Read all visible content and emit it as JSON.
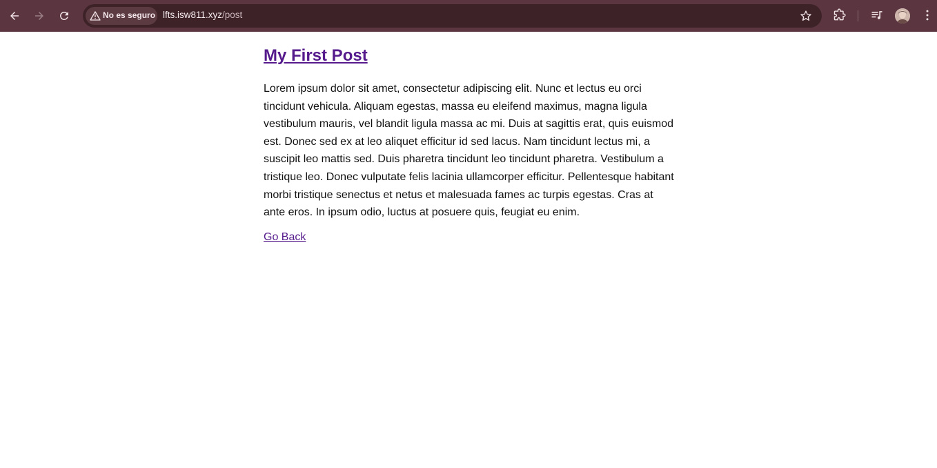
{
  "browser": {
    "security_label": "No es seguro",
    "url_host": "lfts.isw811.xyz",
    "url_path": "/post",
    "toolbar_color": "#5b3540",
    "icons": [
      "back-arrow-icon",
      "forward-arrow-icon",
      "reload-icon",
      "warning-icon",
      "star-icon",
      "extensions-icon",
      "media-control-icon",
      "avatar",
      "kebab-menu-icon"
    ]
  },
  "post": {
    "title": "My First Post",
    "body": "Lorem ipsum dolor sit amet, consectetur adipiscing elit. Nunc et lectus eu orci tincidunt vehicula. Aliquam egestas, massa eu eleifend maximus, magna ligula vestibulum mauris, vel blandit ligula massa ac mi. Duis at sagittis erat, quis euismod est. Donec sed ex at leo aliquet efficitur id sed lacus. Nam tincidunt lectus mi, a suscipit leo mattis sed. Duis pharetra tincidunt leo tincidunt pharetra. Vestibulum a tristique leo. Donec vulputate felis lacinia ullamcorper efficitur. Pellentesque habitant morbi tristique senectus et netus et malesuada fames ac turpis egestas. Cras at ante eros. In ipsum odio, luctus at posuere quis, feugiat eu enim.",
    "back_link": "Go Back",
    "link_color": "#551a8b"
  }
}
